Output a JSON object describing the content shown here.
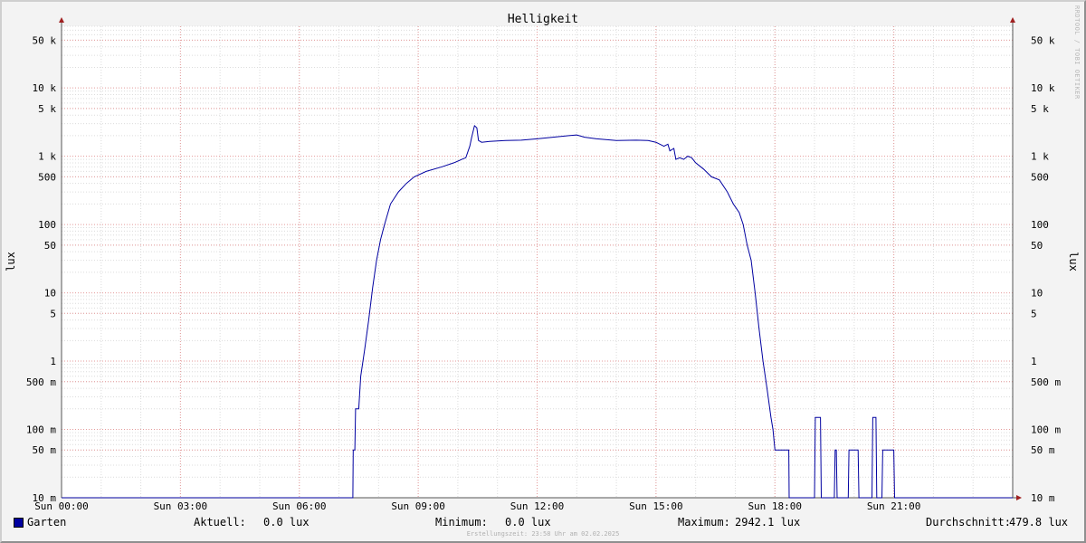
{
  "chart_data": {
    "type": "line",
    "title": "Helligkeit",
    "ylabel": "lux",
    "y_scale": "log",
    "ylim": [
      0.01,
      80000
    ],
    "xlim_hours": [
      0,
      24
    ],
    "x_ticks": [
      {
        "hour": 0,
        "label": "Sun 00:00"
      },
      {
        "hour": 3,
        "label": "Sun 03:00"
      },
      {
        "hour": 6,
        "label": "Sun 06:00"
      },
      {
        "hour": 9,
        "label": "Sun 09:00"
      },
      {
        "hour": 12,
        "label": "Sun 12:00"
      },
      {
        "hour": 15,
        "label": "Sun 15:00"
      },
      {
        "hour": 18,
        "label": "Sun 18:00"
      },
      {
        "hour": 21,
        "label": "Sun 21:00"
      }
    ],
    "y_ticks": [
      {
        "value": 50000,
        "label": "50 k"
      },
      {
        "value": 10000,
        "label": "10 k"
      },
      {
        "value": 5000,
        "label": "5 k"
      },
      {
        "value": 1000,
        "label": "1 k"
      },
      {
        "value": 500,
        "label": "500"
      },
      {
        "value": 100,
        "label": "100"
      },
      {
        "value": 50,
        "label": "50"
      },
      {
        "value": 10,
        "label": "10"
      },
      {
        "value": 5,
        "label": "5"
      },
      {
        "value": 1,
        "label": "1"
      },
      {
        "value": 0.5,
        "label": "500 m"
      },
      {
        "value": 0.1,
        "label": "100 m"
      },
      {
        "value": 0.05,
        "label": "50 m"
      },
      {
        "value": 0.01,
        "label": "10 m"
      }
    ],
    "grid": true,
    "series": [
      {
        "name": "Garten",
        "color": "#0000a0",
        "points": [
          [
            0,
            0.01
          ],
          [
            7.35,
            0.01
          ],
          [
            7.36,
            0.05
          ],
          [
            7.4,
            0.05
          ],
          [
            7.42,
            0.2
          ],
          [
            7.5,
            0.2
          ],
          [
            7.55,
            0.6
          ],
          [
            7.65,
            1.5
          ],
          [
            7.75,
            4
          ],
          [
            7.85,
            12
          ],
          [
            7.95,
            30
          ],
          [
            8.05,
            60
          ],
          [
            8.15,
            100
          ],
          [
            8.3,
            200
          ],
          [
            8.5,
            300
          ],
          [
            8.7,
            400
          ],
          [
            8.9,
            500
          ],
          [
            9.2,
            600
          ],
          [
            9.6,
            700
          ],
          [
            9.9,
            800
          ],
          [
            10.1,
            900
          ],
          [
            10.2,
            950
          ],
          [
            10.3,
            1400
          ],
          [
            10.35,
            1900
          ],
          [
            10.42,
            2800
          ],
          [
            10.48,
            2600
          ],
          [
            10.52,
            1700
          ],
          [
            10.6,
            1600
          ],
          [
            10.8,
            1650
          ],
          [
            11.2,
            1700
          ],
          [
            11.6,
            1720
          ],
          [
            12.0,
            1800
          ],
          [
            12.4,
            1900
          ],
          [
            12.8,
            2000
          ],
          [
            13.0,
            2050
          ],
          [
            13.2,
            1900
          ],
          [
            13.5,
            1800
          ],
          [
            14.0,
            1700
          ],
          [
            14.5,
            1720
          ],
          [
            14.8,
            1700
          ],
          [
            15.0,
            1600
          ],
          [
            15.2,
            1400
          ],
          [
            15.3,
            1500
          ],
          [
            15.35,
            1200
          ],
          [
            15.45,
            1300
          ],
          [
            15.5,
            900
          ],
          [
            15.6,
            950
          ],
          [
            15.7,
            900
          ],
          [
            15.8,
            1000
          ],
          [
            15.9,
            950
          ],
          [
            16.0,
            800
          ],
          [
            16.2,
            650
          ],
          [
            16.4,
            500
          ],
          [
            16.6,
            450
          ],
          [
            16.8,
            300
          ],
          [
            16.95,
            200
          ],
          [
            17.1,
            150
          ],
          [
            17.2,
            100
          ],
          [
            17.3,
            50
          ],
          [
            17.4,
            30
          ],
          [
            17.5,
            10
          ],
          [
            17.6,
            3
          ],
          [
            17.7,
            1
          ],
          [
            17.8,
            0.4
          ],
          [
            17.9,
            0.15
          ],
          [
            17.95,
            0.1
          ],
          [
            18.0,
            0.05
          ],
          [
            18.35,
            0.05
          ],
          [
            18.36,
            0.01
          ],
          [
            19.0,
            0.01
          ],
          [
            19.02,
            0.15
          ],
          [
            19.15,
            0.15
          ],
          [
            19.17,
            0.01
          ],
          [
            19.5,
            0.01
          ],
          [
            19.52,
            0.05
          ],
          [
            19.55,
            0.05
          ],
          [
            19.57,
            0.01
          ],
          [
            19.85,
            0.01
          ],
          [
            19.87,
            0.05
          ],
          [
            20.1,
            0.05
          ],
          [
            20.12,
            0.01
          ],
          [
            20.45,
            0.01
          ],
          [
            20.47,
            0.15
          ],
          [
            20.55,
            0.15
          ],
          [
            20.57,
            0.01
          ],
          [
            20.7,
            0.01
          ],
          [
            20.72,
            0.05
          ],
          [
            21.0,
            0.05
          ],
          [
            21.02,
            0.01
          ],
          [
            24.0,
            0.01
          ]
        ]
      }
    ]
  },
  "legend": {
    "series_name": "Garten",
    "current_label": "Aktuell:",
    "current_value": "0.0 lux",
    "min_label": "Minimum:",
    "min_value": "0.0 lux",
    "max_label": "Maximum:",
    "max_value": "2942.1 lux",
    "avg_label": "Durchschnitt:",
    "avg_value": "479.8 lux"
  },
  "footer": "Erstellungszeit: 23:58 Uhr am 02.02.2025",
  "watermark": "RRDTOOL / TOBI OETIKER"
}
